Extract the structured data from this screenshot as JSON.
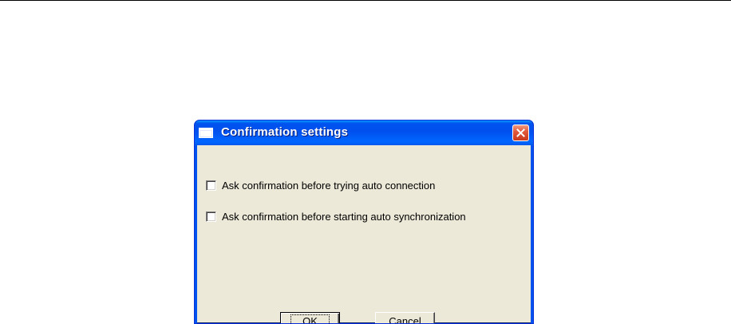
{
  "dialog": {
    "title": "Confirmation settings",
    "title_icon": "window-icon",
    "close_icon": "close-icon",
    "options": [
      {
        "label": "Ask confirmation before trying auto connection",
        "checked": false
      },
      {
        "label": "Ask confirmation before starting auto synchronization",
        "checked": false
      }
    ],
    "buttons": {
      "ok_label": "OK",
      "cancel_label": "Cancel"
    }
  },
  "colors": {
    "titlebar": "#0053ee",
    "client_background": "#ece9d8",
    "close_button": "#e2593c"
  }
}
